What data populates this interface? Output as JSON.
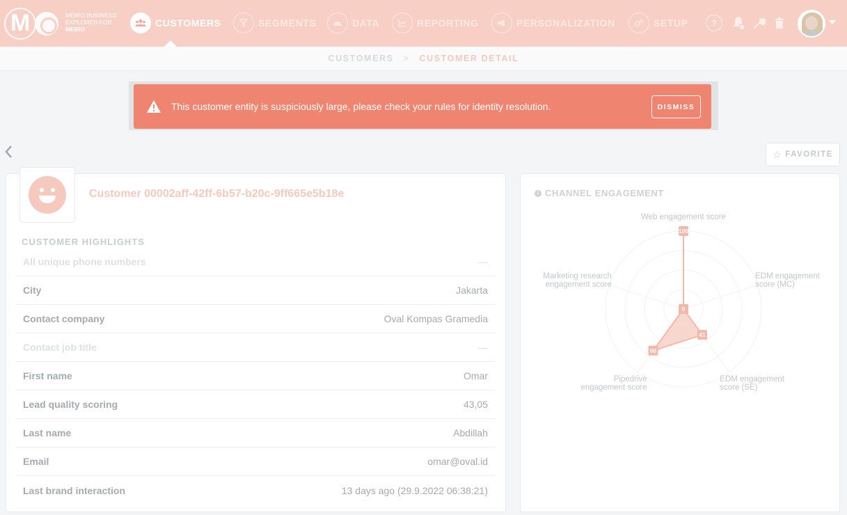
{
  "nav": {
    "logo_text": "M",
    "brand_line1": "MEIRO BUSINESS",
    "brand_line2": "EXPLORER FOR",
    "brand_line3": "MEIRO",
    "items": [
      {
        "label": "CUSTOMERS",
        "icon": "users-icon",
        "active": true
      },
      {
        "label": "SEGMENTS",
        "icon": "filter-icon",
        "active": false
      },
      {
        "label": "DATA",
        "icon": "gauge-icon",
        "active": false
      },
      {
        "label": "REPORTING",
        "icon": "chart-icon",
        "active": false
      },
      {
        "label": "PERSONALIZATION",
        "icon": "megaphone-icon",
        "active": false
      },
      {
        "label": "SETUP",
        "icon": "gears-icon",
        "active": false
      }
    ],
    "tools": [
      "help-icon",
      "bell-icon",
      "wrench-icon",
      "trash-icon"
    ],
    "help_label": "?"
  },
  "breadcrumb": {
    "parent": "CUSTOMERS",
    "separator": ">",
    "current": "CUSTOMER DETAIL"
  },
  "alert": {
    "message": "This customer entity is suspiciously large, please check your rules for identity resolution.",
    "dismiss_label": "DISMISS",
    "color": "#ef8570"
  },
  "favorite_label": "FAVORITE",
  "customer": {
    "name": "Customer 00002aff-42ff-6b57-b20c-9ff665e5b18e",
    "highlights_title": "CUSTOMER HIGHLIGHTS",
    "attributes": [
      {
        "label": "All unique phone numbers",
        "value": "—",
        "empty": true
      },
      {
        "label": "City",
        "value": "Jakarta",
        "empty": false
      },
      {
        "label": "Contact company",
        "value": "Oval Kompas Gramedia",
        "empty": false
      },
      {
        "label": "Contact job title",
        "value": "—",
        "empty": true
      },
      {
        "label": "First name",
        "value": "Omar",
        "empty": false
      },
      {
        "label": "Lead quality scoring",
        "value": "43,05",
        "empty": false
      },
      {
        "label": "Last name",
        "value": "Abdillah",
        "empty": false
      },
      {
        "label": "Email",
        "value": "omar@oval.id",
        "empty": false
      },
      {
        "label": "Last brand interaction",
        "value": "13 days ago (29.9.2022 06:38:21)",
        "empty": false
      }
    ]
  },
  "chart_data": {
    "type": "radar",
    "title": "CHANNEL ENGAGEMENT",
    "axes": [
      {
        "label_lines": [
          "Web engagement score"
        ],
        "value": 100
      },
      {
        "label_lines": [
          "EDM engagement",
          "score (MC)"
        ],
        "value": 0
      },
      {
        "label_lines": [
          "EDM engagement",
          "score (SE)"
        ],
        "value": 41
      },
      {
        "label_lines": [
          "Pipedrive",
          "engagement score"
        ],
        "value": 66
      },
      {
        "label_lines": [
          "Marketing research",
          "engagement score"
        ],
        "value": 0
      }
    ],
    "range": [
      0,
      100
    ],
    "fill_color": "#f6c9bd",
    "stroke_color": "#f4b7a8"
  }
}
